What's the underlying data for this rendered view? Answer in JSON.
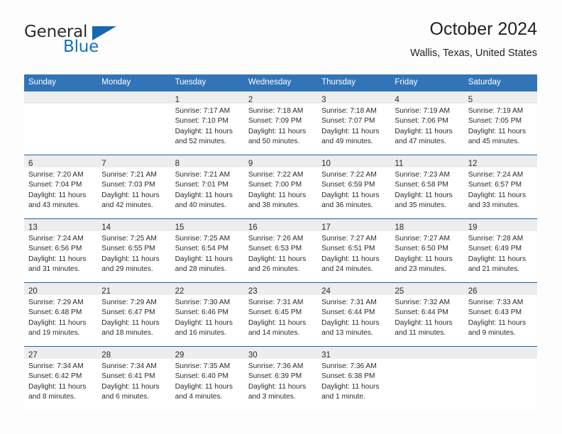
{
  "logo": {
    "word_one": "General",
    "word_two": "Blue",
    "flag_icon": "blue-triangle-flag"
  },
  "header": {
    "title": "October 2024",
    "subtitle": "Wallis, Texas, United States"
  },
  "colors": {
    "header_blue": "#3174b8",
    "row_divider_blue": "#1e63a8",
    "day_band_gray": "#ededed",
    "logo_blue": "#1172bb",
    "text": "#2b2b2b"
  },
  "weekdays": [
    "Sunday",
    "Monday",
    "Tuesday",
    "Wednesday",
    "Thursday",
    "Friday",
    "Saturday"
  ],
  "weeks": [
    [
      {
        "day": "",
        "lines": []
      },
      {
        "day": "",
        "lines": []
      },
      {
        "day": "1",
        "lines": [
          "Sunrise: 7:17 AM",
          "Sunset: 7:10 PM",
          "Daylight: 11 hours",
          "and 52 minutes."
        ]
      },
      {
        "day": "2",
        "lines": [
          "Sunrise: 7:18 AM",
          "Sunset: 7:09 PM",
          "Daylight: 11 hours",
          "and 50 minutes."
        ]
      },
      {
        "day": "3",
        "lines": [
          "Sunrise: 7:18 AM",
          "Sunset: 7:07 PM",
          "Daylight: 11 hours",
          "and 49 minutes."
        ]
      },
      {
        "day": "4",
        "lines": [
          "Sunrise: 7:19 AM",
          "Sunset: 7:06 PM",
          "Daylight: 11 hours",
          "and 47 minutes."
        ]
      },
      {
        "day": "5",
        "lines": [
          "Sunrise: 7:19 AM",
          "Sunset: 7:05 PM",
          "Daylight: 11 hours",
          "and 45 minutes."
        ]
      }
    ],
    [
      {
        "day": "6",
        "lines": [
          "Sunrise: 7:20 AM",
          "Sunset: 7:04 PM",
          "Daylight: 11 hours",
          "and 43 minutes."
        ]
      },
      {
        "day": "7",
        "lines": [
          "Sunrise: 7:21 AM",
          "Sunset: 7:03 PM",
          "Daylight: 11 hours",
          "and 42 minutes."
        ]
      },
      {
        "day": "8",
        "lines": [
          "Sunrise: 7:21 AM",
          "Sunset: 7:01 PM",
          "Daylight: 11 hours",
          "and 40 minutes."
        ]
      },
      {
        "day": "9",
        "lines": [
          "Sunrise: 7:22 AM",
          "Sunset: 7:00 PM",
          "Daylight: 11 hours",
          "and 38 minutes."
        ]
      },
      {
        "day": "10",
        "lines": [
          "Sunrise: 7:22 AM",
          "Sunset: 6:59 PM",
          "Daylight: 11 hours",
          "and 36 minutes."
        ]
      },
      {
        "day": "11",
        "lines": [
          "Sunrise: 7:23 AM",
          "Sunset: 6:58 PM",
          "Daylight: 11 hours",
          "and 35 minutes."
        ]
      },
      {
        "day": "12",
        "lines": [
          "Sunrise: 7:24 AM",
          "Sunset: 6:57 PM",
          "Daylight: 11 hours",
          "and 33 minutes."
        ]
      }
    ],
    [
      {
        "day": "13",
        "lines": [
          "Sunrise: 7:24 AM",
          "Sunset: 6:56 PM",
          "Daylight: 11 hours",
          "and 31 minutes."
        ]
      },
      {
        "day": "14",
        "lines": [
          "Sunrise: 7:25 AM",
          "Sunset: 6:55 PM",
          "Daylight: 11 hours",
          "and 29 minutes."
        ]
      },
      {
        "day": "15",
        "lines": [
          "Sunrise: 7:25 AM",
          "Sunset: 6:54 PM",
          "Daylight: 11 hours",
          "and 28 minutes."
        ]
      },
      {
        "day": "16",
        "lines": [
          "Sunrise: 7:26 AM",
          "Sunset: 6:53 PM",
          "Daylight: 11 hours",
          "and 26 minutes."
        ]
      },
      {
        "day": "17",
        "lines": [
          "Sunrise: 7:27 AM",
          "Sunset: 6:51 PM",
          "Daylight: 11 hours",
          "and 24 minutes."
        ]
      },
      {
        "day": "18",
        "lines": [
          "Sunrise: 7:27 AM",
          "Sunset: 6:50 PM",
          "Daylight: 11 hours",
          "and 23 minutes."
        ]
      },
      {
        "day": "19",
        "lines": [
          "Sunrise: 7:28 AM",
          "Sunset: 6:49 PM",
          "Daylight: 11 hours",
          "and 21 minutes."
        ]
      }
    ],
    [
      {
        "day": "20",
        "lines": [
          "Sunrise: 7:29 AM",
          "Sunset: 6:48 PM",
          "Daylight: 11 hours",
          "and 19 minutes."
        ]
      },
      {
        "day": "21",
        "lines": [
          "Sunrise: 7:29 AM",
          "Sunset: 6:47 PM",
          "Daylight: 11 hours",
          "and 18 minutes."
        ]
      },
      {
        "day": "22",
        "lines": [
          "Sunrise: 7:30 AM",
          "Sunset: 6:46 PM",
          "Daylight: 11 hours",
          "and 16 minutes."
        ]
      },
      {
        "day": "23",
        "lines": [
          "Sunrise: 7:31 AM",
          "Sunset: 6:45 PM",
          "Daylight: 11 hours",
          "and 14 minutes."
        ]
      },
      {
        "day": "24",
        "lines": [
          "Sunrise: 7:31 AM",
          "Sunset: 6:44 PM",
          "Daylight: 11 hours",
          "and 13 minutes."
        ]
      },
      {
        "day": "25",
        "lines": [
          "Sunrise: 7:32 AM",
          "Sunset: 6:44 PM",
          "Daylight: 11 hours",
          "and 11 minutes."
        ]
      },
      {
        "day": "26",
        "lines": [
          "Sunrise: 7:33 AM",
          "Sunset: 6:43 PM",
          "Daylight: 11 hours",
          "and 9 minutes."
        ]
      }
    ],
    [
      {
        "day": "27",
        "lines": [
          "Sunrise: 7:34 AM",
          "Sunset: 6:42 PM",
          "Daylight: 11 hours",
          "and 8 minutes."
        ]
      },
      {
        "day": "28",
        "lines": [
          "Sunrise: 7:34 AM",
          "Sunset: 6:41 PM",
          "Daylight: 11 hours",
          "and 6 minutes."
        ]
      },
      {
        "day": "29",
        "lines": [
          "Sunrise: 7:35 AM",
          "Sunset: 6:40 PM",
          "Daylight: 11 hours",
          "and 4 minutes."
        ]
      },
      {
        "day": "30",
        "lines": [
          "Sunrise: 7:36 AM",
          "Sunset: 6:39 PM",
          "Daylight: 11 hours",
          "and 3 minutes."
        ]
      },
      {
        "day": "31",
        "lines": [
          "Sunrise: 7:36 AM",
          "Sunset: 6:38 PM",
          "Daylight: 11 hours",
          "and 1 minute."
        ]
      },
      {
        "day": "",
        "lines": []
      },
      {
        "day": "",
        "lines": []
      }
    ]
  ]
}
